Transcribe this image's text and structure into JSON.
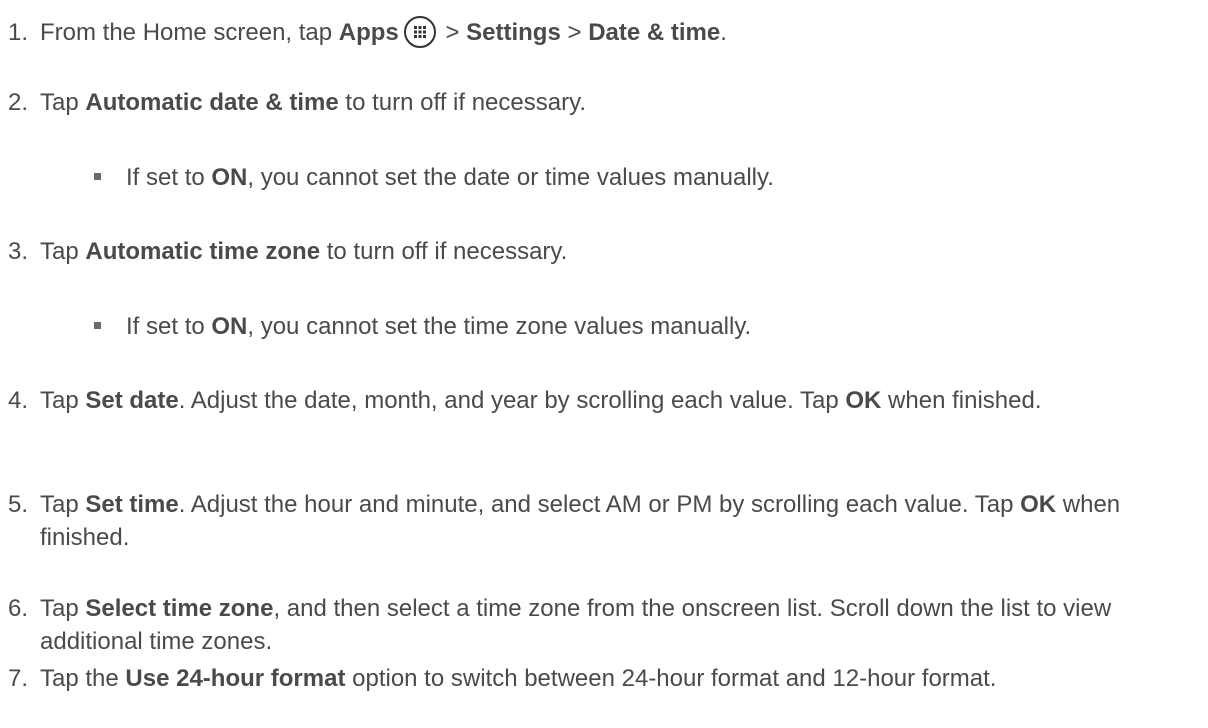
{
  "steps": [
    {
      "num": "1.",
      "segments": {
        "a": "From the Home screen, tap ",
        "b": "Apps",
        "c": " > ",
        "d": "Settings",
        "e": " > ",
        "f": "Date & time",
        "g": "."
      },
      "icon": "apps-grid-icon"
    },
    {
      "num": "2.",
      "segments": {
        "a": "Tap ",
        "b": "Automatic date & time",
        "c": " to turn off if necessary."
      }
    },
    {
      "num": "3.",
      "segments": {
        "a": "Tap ",
        "b": "Automatic time zone",
        "c": " to turn off if necessary."
      }
    },
    {
      "num": "4.",
      "segments": {
        "a": "Tap ",
        "b": "Set date",
        "c": ". Adjust the date, month, and year by scrolling each value. Tap ",
        "d": "OK",
        "e": " when finished."
      }
    },
    {
      "num": "5.",
      "segments": {
        "a": "Tap ",
        "b": "Set time",
        "c": ". Adjust the hour and minute, and select AM or PM by scrolling each value. Tap ",
        "d": "OK",
        "e": " when finished."
      }
    },
    {
      "num": "6.",
      "segments": {
        "a": "Tap ",
        "b": "Select time zone",
        "c": ", and then select a time zone from the onscreen list. Scroll down the list to view additional time zones."
      }
    },
    {
      "num": "7.",
      "segments": {
        "a": "Tap the ",
        "b": "Use 24-hour format",
        "c": " option to switch between 24-hour format and 12-hour format."
      }
    }
  ],
  "bullets": [
    {
      "a": "If set to ",
      "b": "ON",
      "c": ", you cannot set the date or time values manually."
    },
    {
      "a": "If set to ",
      "b": "ON",
      "c": ", you cannot set the time zone values manually."
    }
  ]
}
